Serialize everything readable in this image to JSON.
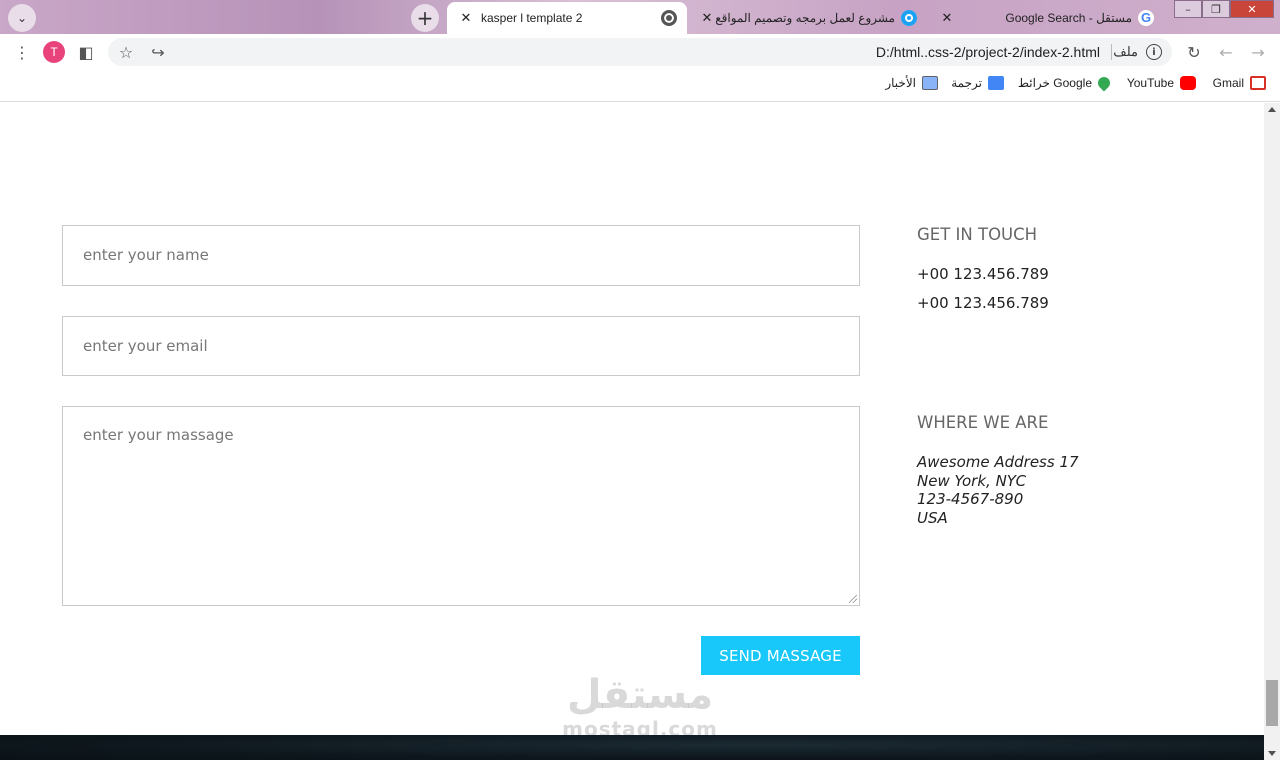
{
  "browser": {
    "tabs": [
      {
        "title": "kasper l template 2",
        "active": true,
        "icon": "globe-icon"
      },
      {
        "title": "مشروع لعمل برمجه وتصميم المواقع | مستق",
        "active": false,
        "icon": "mostaql-icon"
      },
      {
        "title": "مستقل - Google Search",
        "active": false,
        "icon": "google-icon"
      }
    ],
    "profile_initial": "T",
    "url": "D:/html..css-2/project-2/index-2.html",
    "url_file_label": "ملف",
    "bookmarks": [
      {
        "label": "Gmail",
        "icon": "gmail-icon"
      },
      {
        "label": "YouTube",
        "icon": "youtube-icon"
      },
      {
        "label": "خرائط Google",
        "icon": "maps-icon"
      },
      {
        "label": "ترجمة",
        "icon": "translate-icon"
      },
      {
        "label": "الأخبار",
        "icon": "news-icon"
      }
    ]
  },
  "form": {
    "name_placeholder": "enter your name",
    "email_placeholder": "enter your email",
    "message_placeholder": "enter your massage",
    "submit_label": "SEND MASSAGE"
  },
  "contact": {
    "touch_heading": "GET IN TOUCH",
    "phones": [
      "+00 123.456.789",
      "+00 123.456.789"
    ],
    "where_heading": "WHERE WE ARE",
    "address_lines": [
      "Awesome Address 17",
      "New York, NYC",
      "123-4567-890",
      "USA"
    ]
  },
  "watermark": {
    "arabic": "مستقل",
    "latin": "mostaql.com"
  },
  "colors": {
    "accent": "#19c8fa",
    "tab_bar": "#c9a7c8",
    "footer": "#0e171d"
  }
}
